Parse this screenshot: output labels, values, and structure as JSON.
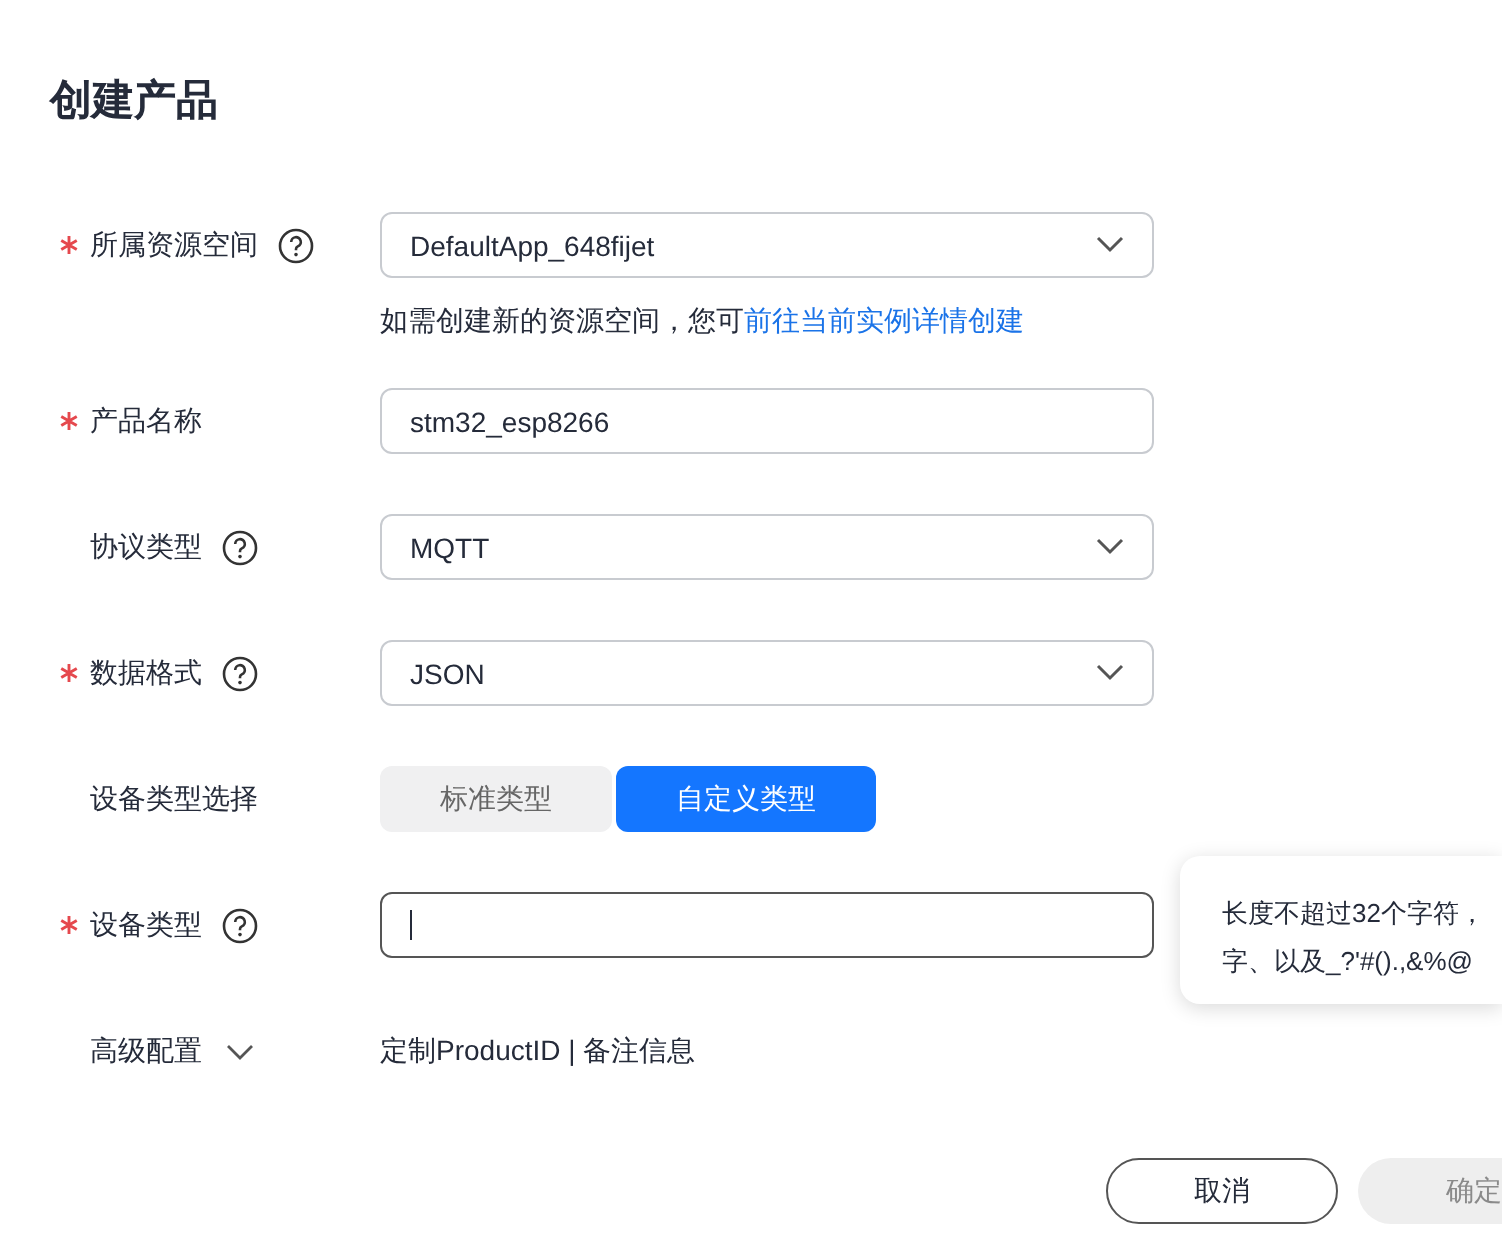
{
  "title": "创建产品",
  "fields": [
    {
      "kind": "select",
      "label": "所属资源空间",
      "required": true,
      "help": true,
      "value": "DefaultApp_648fijet",
      "hint": "如需创建新的资源空间，您可",
      "hint_link": "前往当前实例详情创建"
    },
    {
      "kind": "input",
      "label": "产品名称",
      "required": true,
      "help": false,
      "value": "stm32_esp8266",
      "focused": false
    },
    {
      "kind": "select",
      "label": "协议类型",
      "required": false,
      "help": true,
      "value": "MQTT"
    },
    {
      "kind": "select",
      "label": "数据格式",
      "required": true,
      "help": true,
      "value": "JSON"
    },
    {
      "kind": "segmented",
      "label": "设备类型选择",
      "required": false,
      "help": false,
      "options": [
        {
          "label": "标准类型",
          "selected": false
        },
        {
          "label": "自定义类型",
          "selected": true
        }
      ]
    },
    {
      "kind": "input",
      "label": "设备类型",
      "required": true,
      "help": true,
      "focused": true
    },
    {
      "kind": "expander",
      "label": "高级配置",
      "required": false,
      "help": false,
      "expanded": false,
      "value": "定制ProductID | 备注信息"
    }
  ],
  "tooltip": [
    "长度不超过32个字符，",
    "字、以及_?'#().,&%@"
  ],
  "buttons": [
    {
      "kind": "cancel",
      "label": "取消",
      "disabled": false
    },
    {
      "kind": "confirm",
      "label": "确定",
      "disabled": true
    }
  ]
}
